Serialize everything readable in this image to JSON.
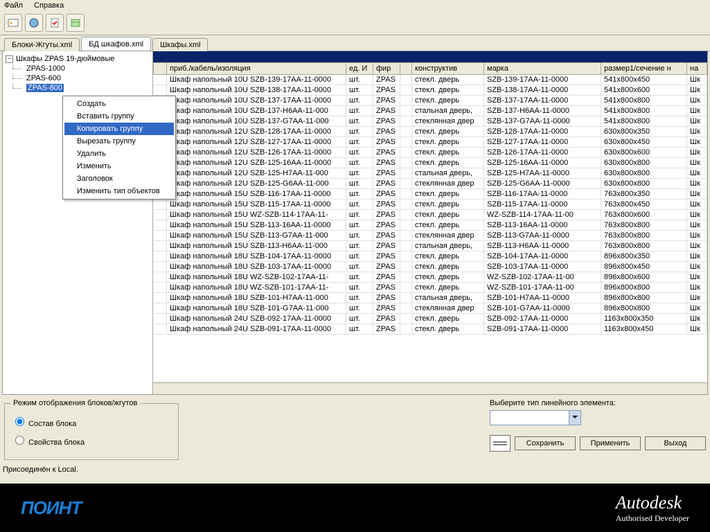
{
  "menu": {
    "file": "Файл",
    "help": "Справка"
  },
  "tabs": {
    "t1": "Блоки-Жгуты.xml",
    "t2": "БД шкафов.xml",
    "t3": "Шкафы.xml"
  },
  "tree": {
    "root": "Шкафы ZPAS 19-дюймовые",
    "n1": "ZPAS-1000",
    "n2": "ZPAS-600",
    "n3": "ZPAS-800"
  },
  "ctx": {
    "create": "Создать",
    "insert": "Вставить группу",
    "copy": "Копировать группу",
    "cut": "Вырезать группу",
    "delete": "Удалить",
    "edit": "Изменить",
    "header": "Заголовок",
    "changetype": "Изменить тип объектов"
  },
  "cols": {
    "c0": "",
    "c1": "приб./кабель/изоляция",
    "c2": "ед. И",
    "c3": "фир",
    "c31": "",
    "c4": "конструктив",
    "c5": "марка",
    "c6": "размер1/сечение н",
    "c7": "на"
  },
  "rows": [
    {
      "a": "Шкаф напольный 10U SZB-139-17AA-11-0000",
      "b": "шт.",
      "c": "ZPAS",
      "d": "стекл. дверь",
      "e": "SZB-139-17AA-11-0000",
      "f": "541x800x450",
      "g": "Шк"
    },
    {
      "a": "Шкаф напольный 10U SZB-138-17AA-11-0000",
      "b": "шт.",
      "c": "ZPAS",
      "d": "стекл. дверь",
      "e": "SZB-138-17AA-11-0000",
      "f": "541x800x600",
      "g": "Шк"
    },
    {
      "a": "Шкаф напольный 10U SZB-137-17AA-11-0000",
      "b": "шт.",
      "c": "ZPAS",
      "d": "стекл. дверь",
      "e": "SZB-137-17AA-11-0000",
      "f": "541x800x800",
      "g": "Шк"
    },
    {
      "a": "Шкаф напольный 10U SZB-137-H6AA-11-000",
      "b": "шт.",
      "c": "ZPAS",
      "d": "стальная дверь,",
      "e": "SZB-137-H6AA-11-0000",
      "f": "541x800x800",
      "g": "Шк"
    },
    {
      "a": "Шкаф напольный 10U SZB-137-G7AA-11-000",
      "b": "шт.",
      "c": "ZPAS",
      "d": "стеклянная двер",
      "e": "SZB-137-G7AA-11-0000",
      "f": "541x800x800",
      "g": "Шк"
    },
    {
      "a": "Шкаф напольный 12U SZB-128-17AA-11-0000",
      "b": "шт.",
      "c": "ZPAS",
      "d": "стекл. дверь",
      "e": "SZB-128-17AA-11-0000",
      "f": "630x800x350",
      "g": "Шк"
    },
    {
      "a": "Шкаф напольный 12U SZB-127-17AA-11-0000",
      "b": "шт.",
      "c": "ZPAS",
      "d": "стекл. дверь",
      "e": "SZB-127-17AA-11-0000",
      "f": "630x800x450",
      "g": "Шк"
    },
    {
      "a": "Шкаф напольный 12U SZB-126-17AA-11-0000",
      "b": "шт.",
      "c": "ZPAS",
      "d": "стекл. дверь",
      "e": "SZB-126-17AA-11-0000",
      "f": "630x800x600",
      "g": "Шк"
    },
    {
      "a": "Шкаф напольный 12U SZB-125-16AA-11-0000",
      "b": "шт.",
      "c": "ZPAS",
      "d": "стекл. дверь",
      "e": "SZB-125-16AA-11-0000",
      "f": "630x800x800",
      "g": "Шк"
    },
    {
      "a": "Шкаф напольный 12U SZB-125-H7AA-11-000",
      "b": "шт.",
      "c": "ZPAS",
      "d": "стальная дверь,",
      "e": "SZB-125-H7AA-11-0000",
      "f": "630x800x800",
      "g": "Шк"
    },
    {
      "a": "Шкаф напольный 12U SZB-125-G6AA-11-000",
      "b": "шт.",
      "c": "ZPAS",
      "d": "стеклянная двер",
      "e": "SZB-125-G6AA-11-0000",
      "f": "630x800x800",
      "g": "Шк"
    },
    {
      "a": "Шкаф напольный 15U SZB-116-17AA-11-0000",
      "b": "шт.",
      "c": "ZPAS",
      "d": "стекл. дверь",
      "e": "SZB-116-17AA-11-0000",
      "f": "763x800x350",
      "g": "Шк"
    },
    {
      "a": "Шкаф напольный 15U SZB-115-17AA-11-0000",
      "b": "шт.",
      "c": "ZPAS",
      "d": "стекл. дверь",
      "e": "SZB-115-17AA-11-0000",
      "f": "763x800x450",
      "g": "Шк"
    },
    {
      "a": "Шкаф напольный 15U WZ-SZB-114-17AA-11-",
      "b": "шт.",
      "c": "ZPAS",
      "d": "стекл. дверь",
      "e": "WZ-SZB-114-17AA-11-00",
      "f": "763x800x600",
      "g": "Шк"
    },
    {
      "a": "Шкаф напольный 15U SZB-113-16AA-11-0000",
      "b": "шт.",
      "c": "ZPAS",
      "d": "стекл. дверь",
      "e": "SZB-113-16AA-11-0000",
      "f": "763x800x800",
      "g": "Шк"
    },
    {
      "a": "Шкаф напольный 15U SZB-113-G7AA-11-000",
      "b": "шт.",
      "c": "ZPAS",
      "d": "стеклянная двер",
      "e": "SZB-113-G7AA-11-0000",
      "f": "763x800x800",
      "g": "Шк"
    },
    {
      "a": "Шкаф напольный 15U SZB-113-H6AA-11-000",
      "b": "шт.",
      "c": "ZPAS",
      "d": "стальная дверь,",
      "e": "SZB-113-H6AA-11-0000",
      "f": "763x800x800",
      "g": "Шк"
    },
    {
      "a": "Шкаф напольный 18U SZB-104-17AA-11-0000",
      "b": "шт.",
      "c": "ZPAS",
      "d": "стекл. дверь",
      "e": "SZB-104-17AA-11-0000",
      "f": "896x800x350",
      "g": "Шк"
    },
    {
      "a": "Шкаф напольный 18U SZB-103-17AA-11-0000",
      "b": "шт.",
      "c": "ZPAS",
      "d": "стекл. дверь",
      "e": "SZB-103-17AA-11-0000",
      "f": "896x800x450",
      "g": "Шк"
    },
    {
      "a": "Шкаф напольный 18U WZ-SZB-102-17AA-11-",
      "b": "шт.",
      "c": "ZPAS",
      "d": "стекл. дверь",
      "e": "WZ-SZB-102-17AA-11-00",
      "f": "896x800x600",
      "g": "Шк"
    },
    {
      "a": "Шкаф напольный 18U WZ-SZB-101-17AA-11-",
      "b": "шт.",
      "c": "ZPAS",
      "d": "стекл. дверь",
      "e": "WZ-SZB-101-17AA-11-00",
      "f": "896x800x800",
      "g": "Шк"
    },
    {
      "a": "Шкаф напольный 18U SZB-101-H7AA-11-000",
      "b": "шт.",
      "c": "ZPAS",
      "d": "стальная дверь,",
      "e": "SZB-101-H7AA-11-0000",
      "f": "896x800x800",
      "g": "Шк"
    },
    {
      "a": "Шкаф напольный 18U SZB-101-G7AA-11-000",
      "b": "шт.",
      "c": "ZPAS",
      "d": "стеклянная двер",
      "e": "SZB-101-G7AA-11-0000",
      "f": "896x800x800",
      "g": "Шк"
    },
    {
      "a": "Шкаф напольный 24U SZB-092-17AA-11-0000",
      "b": "шт.",
      "c": "ZPAS",
      "d": "стекл. дверь",
      "e": "SZB-092-17AA-11-0000",
      "f": "1163x800x350",
      "g": "Шк"
    },
    {
      "a": "Шкаф напольный 24U SZB-091-17AA-11-0000",
      "b": "шт.",
      "c": "ZPAS",
      "d": "стекл. дверь",
      "e": "SZB-091-17AA-11-0000",
      "f": "1163x800x450",
      "g": "Шк"
    }
  ],
  "group": {
    "title": "Режим отображения блоков/жгутов",
    "r1": "Состав блока",
    "r2": "Свойства блока"
  },
  "right": {
    "label": "Выберите тип линейного элемента:",
    "save": "Сохранить",
    "apply": "Применить",
    "exit": "Выход"
  },
  "status": "Присоединён к Local.",
  "footer": {
    "left": "ПОИНТ",
    "brand": "Autodesk",
    "sub": "Authorised Developer"
  }
}
